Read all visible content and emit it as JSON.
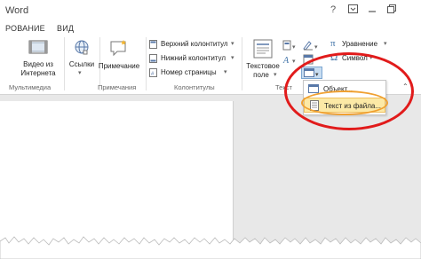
{
  "app": {
    "title": "Word"
  },
  "window_controls": {
    "help": "?",
    "restore": "⧉",
    "minimize": "—",
    "restore2": "❐"
  },
  "tabs": [
    "РОВАНИЕ",
    "ВИД"
  ],
  "ribbon": {
    "media": {
      "video_line1": "Видео из",
      "video_line2": "Интернета",
      "group": "Мультимедиа"
    },
    "links": {
      "label": "Ссылки"
    },
    "comments": {
      "label": "Примечание",
      "group": "Примечания"
    },
    "headers": {
      "header": "Верхний колонтитул",
      "footer": "Нижний колонтитул",
      "page_number": "Номер страницы",
      "group": "Колонтитулы"
    },
    "text": {
      "textbox_line1": "Текстовое",
      "textbox_line2": "поле",
      "group": "Текст"
    },
    "symbols": {
      "equation": "Уравнение",
      "symbol": "Символ"
    }
  },
  "menu": {
    "items": [
      {
        "label": "Объект...",
        "icon": "object-icon"
      },
      {
        "label": "Текст из файла...",
        "icon": "text-file-icon"
      }
    ]
  },
  "colors": {
    "highlight": "#fce9a6",
    "red_oval": "#e11b1b",
    "orange_oval": "#f0a030"
  }
}
